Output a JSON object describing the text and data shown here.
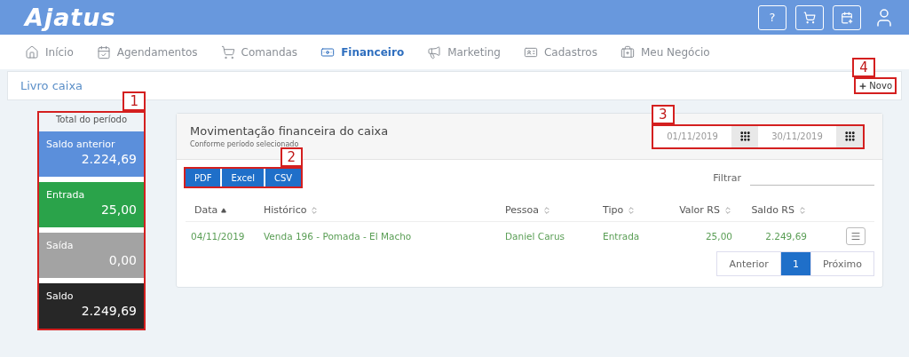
{
  "app": {
    "logo": "Ajatus",
    "header_buttons": [
      {
        "kind": "help",
        "label": "?"
      },
      {
        "kind": "cart"
      },
      {
        "kind": "calendar"
      },
      {
        "kind": "user"
      }
    ]
  },
  "nav": [
    {
      "label": "Início",
      "selected": false
    },
    {
      "label": "Agendamentos",
      "selected": false
    },
    {
      "label": "Comandas",
      "selected": false
    },
    {
      "label": "Financeiro",
      "selected": true
    },
    {
      "label": "Marketing",
      "selected": false
    },
    {
      "label": "Cadastros",
      "selected": false
    },
    {
      "label": "Meu Negócio",
      "selected": false
    }
  ],
  "page": {
    "title": "Livro caixa",
    "new_button": "Novo"
  },
  "totals": {
    "title": "Total do período",
    "items": [
      {
        "label": "Saldo anterior",
        "value": "2.224,69",
        "color": "#5b8fdb"
      },
      {
        "label": "Entrada",
        "value": "25,00",
        "color": "#2aa34a"
      },
      {
        "label": "Saída",
        "value": "0,00",
        "color": "#a3a3a3"
      },
      {
        "label": "Saldo",
        "value": "2.249,69",
        "color": "#272727"
      }
    ]
  },
  "panel": {
    "title": "Movimentação financeira do caixa",
    "subtitle": "Conforme período selecionado",
    "date_from": "01/11/2019",
    "date_to": "30/11/2019",
    "export_buttons": [
      "PDF",
      "Excel",
      "CSV"
    ],
    "filter_label": "Filtrar",
    "columns": [
      {
        "label": "Data",
        "sorted": true
      },
      {
        "label": "Histórico",
        "sorted": false
      },
      {
        "label": "Pessoa",
        "sorted": false
      },
      {
        "label": "Tipo",
        "sorted": false
      },
      {
        "label": "Valor RS",
        "sorted": false
      },
      {
        "label": "Saldo RS",
        "sorted": false
      }
    ],
    "rows": [
      {
        "cells": [
          "04/11/2019",
          "Venda 196 - Pomada - El Macho",
          "Daniel Carus",
          "Entrada",
          "25,00",
          "2.249,69"
        ]
      }
    ],
    "pagination": [
      {
        "label": "Anterior",
        "selected": false
      },
      {
        "label": "1",
        "selected": true
      },
      {
        "label": "Próximo",
        "selected": false
      }
    ]
  },
  "callouts": [
    "1",
    "2",
    "3",
    "4"
  ]
}
